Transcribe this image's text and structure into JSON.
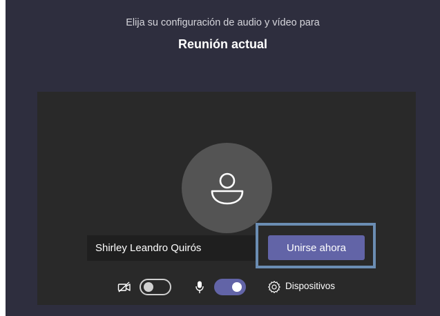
{
  "header": {
    "subtitle": "Elija su configuración de audio y vídeo para",
    "title": "Reunión actual"
  },
  "join": {
    "name_value": "Shirley Leandro Quirós",
    "join_label": "Unirse ahora"
  },
  "controls": {
    "camera": {
      "icon": "camera-off-icon",
      "enabled": false
    },
    "microphone": {
      "icon": "microphone-icon",
      "enabled": true
    },
    "devices_icon": "gear-icon",
    "devices_label": "Dispositivos"
  },
  "colors": {
    "background": "#2e2e3e",
    "panel": "#292929",
    "accent": "#6264a7",
    "highlight_border": "#6b8db3"
  }
}
